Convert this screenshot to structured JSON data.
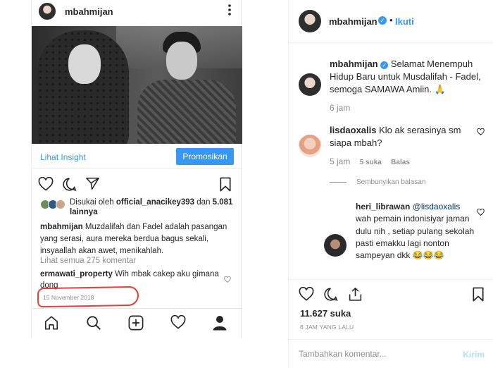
{
  "phone": {
    "username": "mbahmijan",
    "insight_label": "Lihat Insight",
    "promote_label": "Promosikan",
    "liked_prefix": "Disukai oleh ",
    "liked_user": "official_anacikey393",
    "liked_and": " dan ",
    "liked_count": "5.081 lainnya",
    "caption_user": "mbahmijan",
    "caption_text": " Muzdalifah dan Fadel adalah pasangan yang serasi, aura mereka berdua bagus sekali, insyaallah akan awet, menikahlah.",
    "view_all": "Lihat semua 275 komentar",
    "comment_user": "ermawati_property",
    "comment_text": " Wih mbak cakep aku gimana dong​️",
    "date": "15 November 2018"
  },
  "post": {
    "username": "mbahmijan",
    "dot": "•",
    "follow_label": "Ikuti",
    "caption_user": "mbahmijan",
    "caption_text": " Selamat Menempuh Hidup Baru untuk Musdalifah - Fadel, semoga SAMAWA Amiin. 🙏",
    "caption_time": "6 jam",
    "comments": [
      {
        "user": "lisdaoxalis",
        "text": " Klo ak serasinya sm siapa mbah?",
        "time": "5 jam",
        "likes": "5 suka",
        "reply": "Balas"
      }
    ],
    "hide_replies": "Sembunyikan balasan",
    "reply": {
      "user": "heri_librawan",
      "mention": " @lisdaoxalis",
      "text": " wah pemain indonisiyar jaman dulu nih , setiap pulang sekolah pasti emakku lagi nonton sampeyan dkk 😂😂😂"
    },
    "likes_count": "11.627 suka",
    "time_ago": "6 JAM YANG LALU",
    "comment_placeholder": "Tambahkan komentar...",
    "send_label": "Kirim"
  },
  "colors": {
    "accent": "#3897f0",
    "highlight_ring": "#e0413a",
    "muted": "#8e8e8e"
  }
}
